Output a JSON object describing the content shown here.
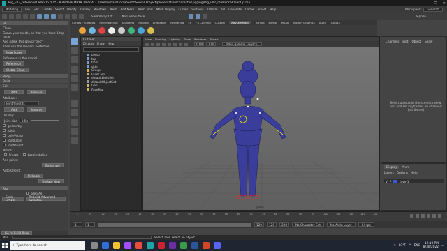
{
  "window": {
    "title": "Rig_v07_referenceCleanUp.ma* - Autodesk MAYA 2022.4: C:\\Users\\shap\\Documents\\Senior Project\\presentation\\character\\rigging\\Rig_v07_referenceCleanUp.ma",
    "minimize": "—",
    "maximize": "❐",
    "close": "✕"
  },
  "menubar": {
    "items": [
      "File",
      "Edit",
      "Create",
      "Select",
      "Modify",
      "Display",
      "Windows",
      "Mesh",
      "Edit Mesh",
      "Mesh Tools",
      "Mesh Display",
      "Curves",
      "Surfaces",
      "Deform",
      "UV",
      "Generate",
      "Cache",
      "Arnold",
      "Help"
    ],
    "workspace_label": "Workspace:",
    "workspace_value": "General*"
  },
  "statusline": {
    "mode": "Modeling",
    "symmetry": "Symmetry: Off",
    "live_surface": "No Live Surface",
    "sign_in": "Sign In"
  },
  "shelf": {
    "tabs": [
      "Curves / Surfaces",
      "Poly Modeling",
      "Sculpting",
      "Rigging",
      "Animation",
      "Rendering",
      "FX",
      "FX Caching",
      "Custom",
      "AdvSkeleton5",
      "Arnold",
      "Bifrost",
      "MASH",
      "Motion Graphics",
      "XGen",
      "TURTLE"
    ],
    "active_tab": "AdvSkeleton5"
  },
  "leftpanel": {
    "sections": {
      "fit": "Fit",
      "body": "Body",
      "build": "Build",
      "edit": "Edit",
      "rig": "Rig"
    },
    "clean_text": "Clean",
    "info_1": "Group your model, so that you have 1 top node",
    "info_2": "And name this group \"geo\"",
    "info_3": "Then use the reorient node tool",
    "clean_button": "New Scene",
    "reference_label": "Reference in the model",
    "reference_button": "Reference",
    "global_clean": "Global Clean",
    "attribute_label": "Attribute:",
    "attribute_value": "Joint/Inherits",
    "add_button": "Add",
    "remove_button": "Remove",
    "display_label": "Display:",
    "joint_size_label": "Joint size",
    "joint_size_value": "0.50",
    "check_items": [
      "geometry",
      "joints",
      "poleVector",
      "jointLabel",
      "jointOrient"
    ],
    "mirror_label": "Mirror:",
    "freeze_label": "Freeze",
    "local_label": "Local rotation",
    "add_joints_label": "Add Joints:",
    "example_button": "ExSample",
    "auto_orient_label": "Auto Orient:",
    "pickable_button": "Pickable",
    "rename_button": "Update Now",
    "keep_all": "Keep All",
    "scale_fit_button": "Scale FitSkel",
    "rebuild_button": "Rebuild Advanced Skeleton",
    "goto_button": "Go to Build Pose"
  },
  "outliner": {
    "title": "Outliner",
    "menus": [
      "Display",
      "Show",
      "Help"
    ],
    "items": [
      "persp",
      "top",
      "front",
      "side",
      "Group",
      "FaceCam",
      "defaultLightSet",
      "defaultObjectSet",
      "Geo",
      "FaceRig"
    ]
  },
  "viewport": {
    "menus": [
      "View",
      "Shading",
      "Lighting",
      "Show",
      "Renderer",
      "Panels"
    ],
    "camera_label": "persp",
    "colorspace": "sRGB gamma (legacy)",
    "exposure": "0.00",
    "gamma": "1.00"
  },
  "channelbox": {
    "tabs": [
      "Channels",
      "Edit",
      "Object",
      "Show"
    ],
    "empty_message": "Select objects in the scene to view, edit and set keyframes on channels (attributes)"
  },
  "layers": {
    "tabs": [
      "Display",
      "Anim"
    ],
    "menus": [
      "Layers",
      "Options",
      "Help"
    ],
    "layer_v": "V",
    "layer_p": "P",
    "layer_name": "layer1"
  },
  "timeslider": {
    "ticks": [
      "1",
      "5",
      "10",
      "15",
      "20",
      "25",
      "30",
      "35",
      "40",
      "45",
      "50",
      "55",
      "60",
      "65",
      "70",
      "75",
      "80",
      "85",
      "90",
      "95",
      "100",
      "105",
      "110",
      "115",
      "120"
    ],
    "current_frame": "1",
    "range_start": "1",
    "range_inner_start": "1",
    "range_inner_end": "120",
    "range_end": "120",
    "range_end_2": "200",
    "fps": "24 fps",
    "char_set": "No Character Set",
    "anim_layer": "No Anim Layer"
  },
  "commandline": {
    "lang": "MEL",
    "help": "Select Tool: select an object"
  },
  "taskbar": {
    "search_placeholder": "Type here to search",
    "temperature": "83°F",
    "language": "ENG",
    "time": "12:10 PM",
    "date": "8/30/2022"
  },
  "colors": {
    "maya_teal": "#1fa5a5",
    "mesh_wire": "#2d2f8c",
    "joint_red": "#ff2020",
    "layer_blue": "#3a57d6"
  }
}
